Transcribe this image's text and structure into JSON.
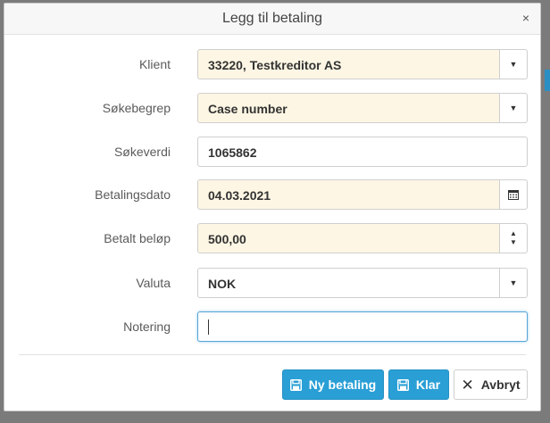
{
  "dialog": {
    "title": "Legg til betaling",
    "close_glyph": "×"
  },
  "form": {
    "client": {
      "label": "Klient",
      "value": "33220, Testkreditor AS"
    },
    "search_term": {
      "label": "Søkebegrep",
      "value": "Case number"
    },
    "search_value": {
      "label": "Søkeverdi",
      "value": "1065862"
    },
    "payment_date": {
      "label": "Betalingsdato",
      "value": "04.03.2021"
    },
    "paid_amount": {
      "label": "Betalt beløp",
      "value": "500,00"
    },
    "currency": {
      "label": "Valuta",
      "value": "NOK"
    },
    "note": {
      "label": "Notering",
      "value": ""
    }
  },
  "glyphs": {
    "dropdown": "▼",
    "spin_up": "▲",
    "spin_down": "▼"
  },
  "buttons": {
    "new_payment": "Ny betaling",
    "done": "Klar",
    "cancel": "Avbryt",
    "cancel_glyph": "✕"
  },
  "colors": {
    "primary": "#2a9fd6",
    "required_field_bg": "#fdf6e4",
    "overlay": "#7b7b7b"
  },
  "icons": [
    "close-icon",
    "chevron-down-icon",
    "calendar-icon",
    "spinner-arrows-icon",
    "save-icon",
    "x-icon"
  ]
}
